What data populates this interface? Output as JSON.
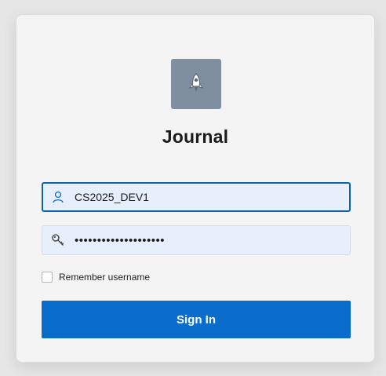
{
  "app": {
    "title": "Journal",
    "logo_icon": "rocket-icon",
    "logo_color": "#7f8fa0"
  },
  "form": {
    "username": {
      "value": "CS2025_DEV1",
      "icon": "user-icon"
    },
    "password": {
      "value": "••••••••••••••••••••",
      "icon": "key-icon"
    },
    "remember_label": "Remember username",
    "remember_checked": false,
    "submit_label": "Sign In"
  },
  "colors": {
    "accent": "#0a6ccb",
    "focus_border": "#0b62ad",
    "field_bg": "#e8effc"
  }
}
